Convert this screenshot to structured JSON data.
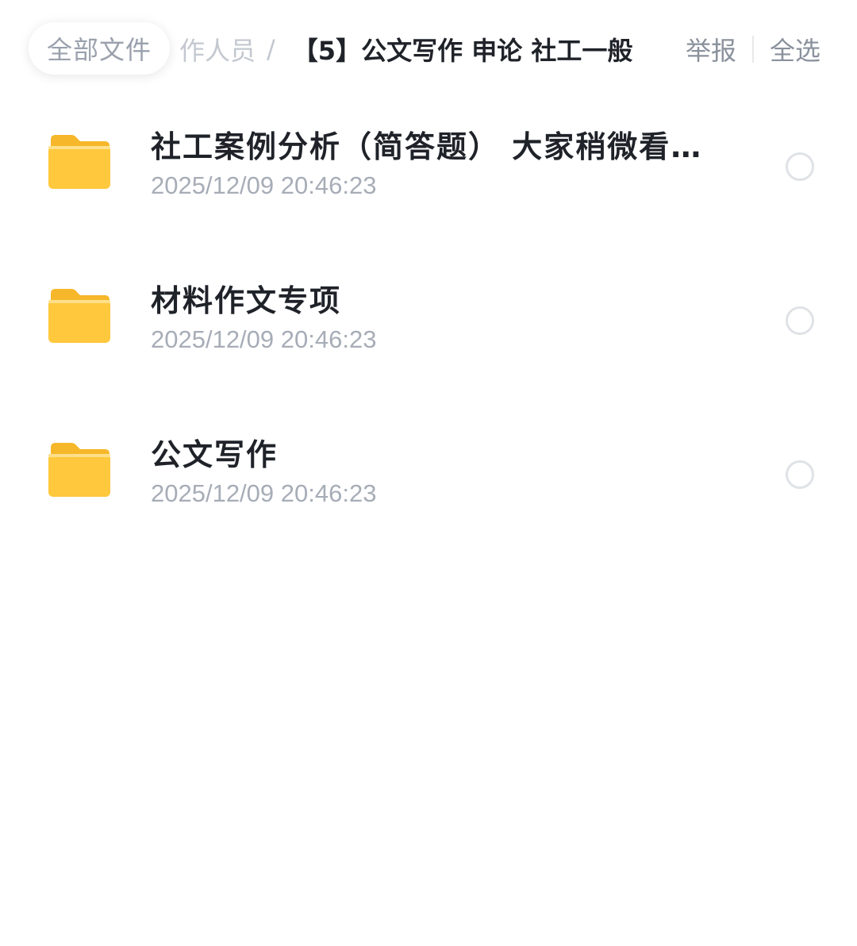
{
  "header": {
    "all_files_label": "全部文件",
    "breadcrumb_prev": "作人员",
    "breadcrumb_separator": "/",
    "breadcrumb_current": "【5】公文写作 申论 社工一般",
    "report_label": "举报",
    "select_all_label": "全选"
  },
  "files": [
    {
      "name": "社工案例分析（简答题） 大家稍微看几…",
      "time": "2025/12/09 20:46:23",
      "icon": "folder-icon"
    },
    {
      "name": "材料作文专项",
      "time": "2025/12/09 20:46:23",
      "icon": "folder-icon"
    },
    {
      "name": "公文写作",
      "time": "2025/12/09 20:46:23",
      "icon": "folder-icon"
    }
  ],
  "colors": {
    "folder_main": "#FFC83D",
    "folder_back": "#F6B72A",
    "title_text": "#1F2329",
    "muted_text": "#A7ADB7"
  }
}
